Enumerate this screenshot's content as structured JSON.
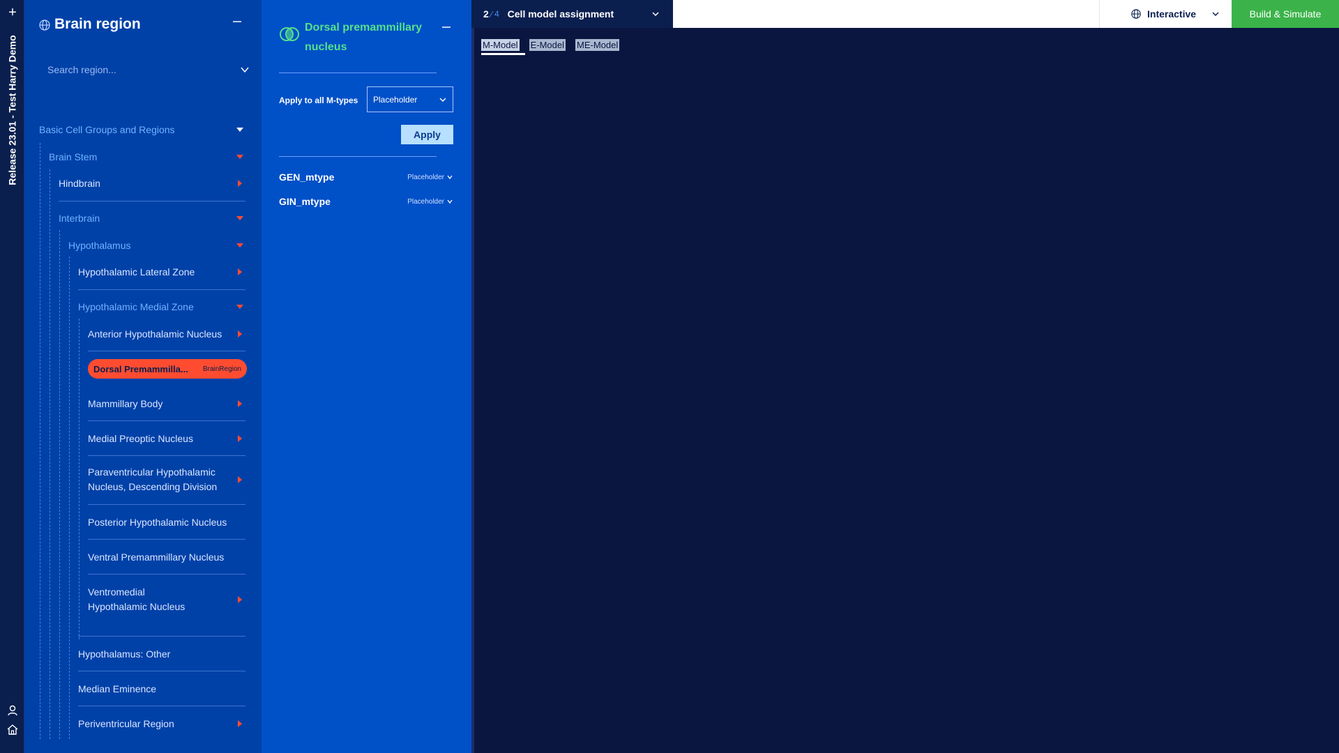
{
  "rail": {
    "title": "Release 23.01 - Test Harry Demo",
    "plus_icon": "plus-icon",
    "user_icon": "user-icon",
    "home_icon": "home-icon"
  },
  "brain_panel": {
    "title": "Brain region",
    "search_placeholder": "Search region...",
    "tree": [
      {
        "label": "Basic Cell Groups and Regions",
        "expanded": true
      },
      {
        "label": "Brain Stem",
        "expanded": true
      },
      {
        "label": "Hindbrain",
        "expanded": false
      },
      {
        "label": "Interbrain",
        "expanded": true
      },
      {
        "label": "Hypothalamus",
        "expanded": true
      },
      {
        "label": "Hypothalamic Lateral Zone",
        "expanded": false
      },
      {
        "label": "Hypothalamic Medial Zone",
        "expanded": true
      },
      {
        "label": "Anterior Hypothalamic Nucleus",
        "expanded": false
      },
      {
        "label": "Dorsal Premammilla...",
        "badge": "BrainRegion",
        "selected": true
      },
      {
        "label": "Mammillary Body",
        "expanded": false
      },
      {
        "label": "Medial Preoptic Nucleus",
        "expanded": false
      },
      {
        "label": "Paraventricular Hypothalamic Nucleus, Descending Division",
        "expanded": false
      },
      {
        "label": "Posterior Hypothalamic Nucleus"
      },
      {
        "label": "Ventral Premammillary Nucleus"
      },
      {
        "label": "Ventromedial Hypothalamic Nucleus",
        "expanded": false
      },
      {
        "label": "Hypothalamus: Other"
      },
      {
        "label": "Median Eminence"
      },
      {
        "label": "Periventricular Region",
        "expanded": false
      }
    ]
  },
  "detail": {
    "region_name": "Dorsal premammillary nucleus",
    "apply_all_label": "Apply to all M-types",
    "apply_all_value": "Placeholder",
    "apply_button": "Apply",
    "mtypes": [
      {
        "name": "GEN_mtype",
        "value": "Placeholder"
      },
      {
        "name": "GIN_mtype",
        "value": "Placeholder"
      }
    ]
  },
  "topbar": {
    "step_num": "2",
    "step_total": "4",
    "step_name": "Cell model assignment",
    "mode_label": "Interactive",
    "build_button": "Build & Simulate"
  },
  "main": {
    "tabs": [
      "M-Model",
      "E-Model",
      "ME-Model"
    ],
    "active_tab": "M-Model"
  },
  "colors": {
    "rail_bg": "#0b1f4f",
    "brain_panel_bg": "#0041a8",
    "detail_bg": "#0050c8",
    "canvas_bg": "#0b1640",
    "selected_pill": "#ff4c30",
    "accent_green": "#3bb34a",
    "region_green": "#55e08a",
    "arrow_red": "#ff4c30"
  }
}
